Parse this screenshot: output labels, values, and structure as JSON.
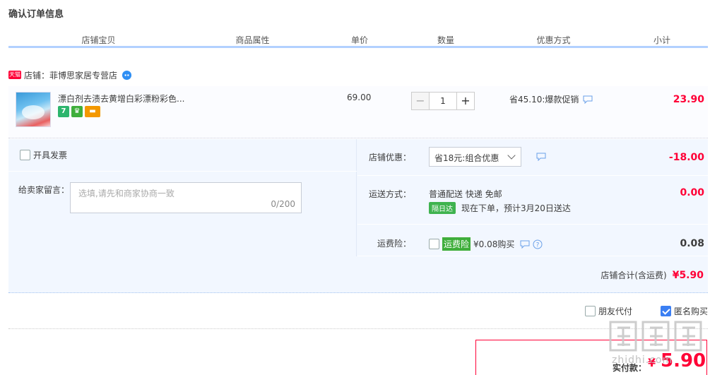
{
  "page_title": "确认订单信息",
  "columns": [
    "店铺宝贝",
    "商品属性",
    "单价",
    "数量",
    "优惠方式",
    "小计"
  ],
  "shop": {
    "badge": "天猫",
    "label": "店铺：菲博思家居专营店"
  },
  "item": {
    "title": "漂白剂去渍去黄增白彩漂粉彩色...",
    "service_icons": [
      {
        "name": "seven-day-return-icon",
        "glyph": "7"
      },
      {
        "name": "guarantee-icon",
        "glyph": "♛"
      },
      {
        "name": "credit-card-icon",
        "glyph": "▬"
      }
    ],
    "unit_price": "69.00",
    "qty_minus": "−",
    "quantity": "1",
    "qty_plus": "+",
    "promo": "省45.10:爆款促销",
    "subtotal": "23.90"
  },
  "extras": {
    "invoice_label": "开具发票",
    "message_label": "给卖家留言：",
    "message_placeholder": "选填,请先和商家协商一致",
    "message_count": "0/200",
    "store_discount_label": "店铺优惠：",
    "store_discount_selected": "省18元:组合优惠",
    "store_discount_amount": "-18.00",
    "shipping_label": "运送方式：",
    "shipping_method": "普通配送 快递 免邮",
    "next_day_badge": "隔日达",
    "delivery_estimate": "现在下单，预计3月20日送达",
    "shipping_amount": "0.00",
    "insurance_label": "运费险：",
    "insurance_badge": "运费险",
    "insurance_price": "¥0.08购买",
    "insurance_amount": "0.08"
  },
  "store_total": {
    "label": "店铺合计(含运费)",
    "value": "¥5.90"
  },
  "options": {
    "friend_pay": "朋友代付",
    "anonymous": "匿名购买"
  },
  "payment": {
    "label": "实付款：",
    "currency": "¥",
    "value": "5.90"
  },
  "watermark": {
    "text": "zhidhi.com"
  },
  "colors": {
    "accent_red": "#ff0036",
    "header_underline": "#b2d1ff",
    "panel_bg": "#f2f7ff",
    "green_badge": "#3fae3b",
    "check_blue": "#3b7ff3"
  }
}
